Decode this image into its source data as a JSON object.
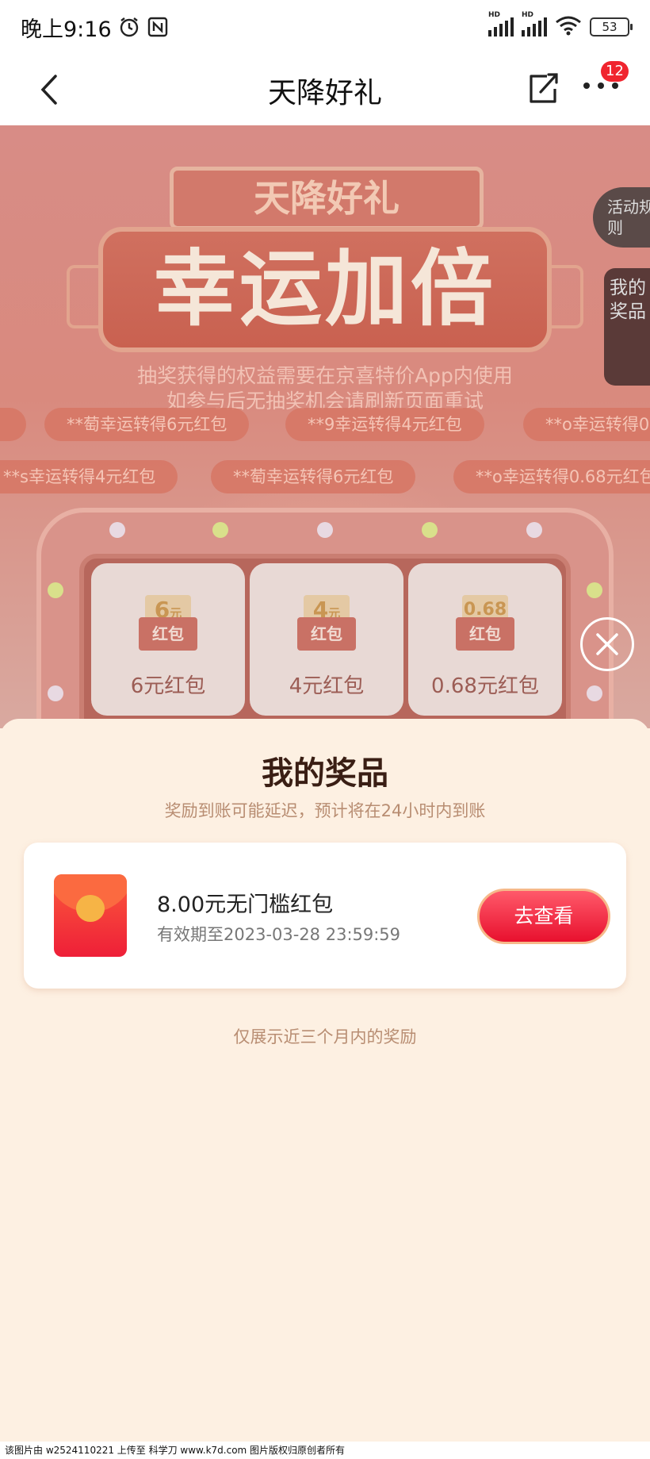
{
  "status_bar": {
    "time": "晚上9:16",
    "signal_label": "HD",
    "battery": "53"
  },
  "nav": {
    "title": "天降好礼",
    "more_badge": "12"
  },
  "hero": {
    "banner_small": "天降好礼",
    "banner_big": "幸运加倍",
    "subtitle_1": "抽奖获得的权益需要在京喜特价App内使用",
    "subtitle_2": "如参与后无抽奖机会请刷新页面重试",
    "ticker_row1": [
      "**萄幸运转得6元红包",
      "**9幸运转得4元红包",
      "**o幸运转得0"
    ],
    "ticker_row2": [
      "**s幸运转得4元红包",
      "**萄幸运转得6元红包",
      "**o幸运转得0.68元红包"
    ],
    "side_rule": "活动规则",
    "side_prize": "我的奖品",
    "prizes": [
      {
        "amount": "6",
        "unit": "元",
        "env_label": "红包",
        "label": "6元红包"
      },
      {
        "amount": "4",
        "unit": "元",
        "env_label": "红包",
        "label": "4元红包"
      },
      {
        "amount": "0.68",
        "unit": "",
        "env_label": "红包",
        "label": "0.68元红包"
      }
    ]
  },
  "sheet": {
    "title": "我的奖品",
    "subtitle": "奖励到账可能延迟，预计将在24小时内到账",
    "prize_card": {
      "name": "8.00元无门槛红包",
      "expiry": "有效期至2023-03-28 23:59:59",
      "button": "去查看"
    },
    "footnote": "仅展示近三个月内的奖励"
  },
  "watermark": "该图片由 w2524110221 上传至 科学刀 www.k7d.com 图片版权归原创者所有"
}
